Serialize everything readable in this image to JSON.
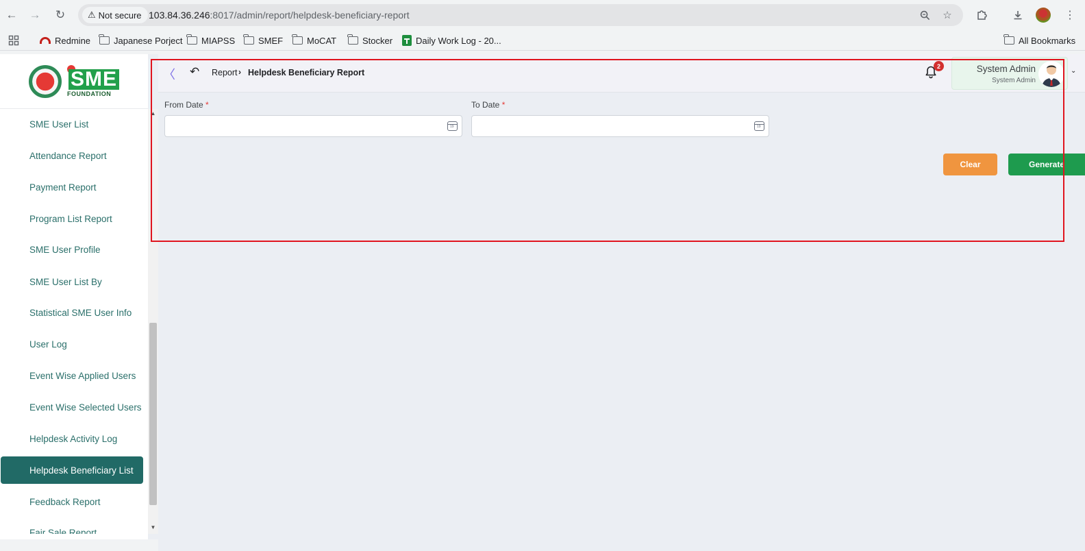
{
  "browser": {
    "security_label": "Not secure",
    "url_host": "103.84.36.246",
    "url_rest": ":8017/admin/report/helpdesk-beneficiary-report",
    "bookmarks": [
      {
        "label": "Redmine",
        "icon": "redmine-icon"
      },
      {
        "label": "Japanese Porject",
        "icon": "folder-icon"
      },
      {
        "label": "MIAPSS",
        "icon": "folder-icon"
      },
      {
        "label": "SMEF",
        "icon": "folder-icon"
      },
      {
        "label": "MoCAT",
        "icon": "folder-icon"
      },
      {
        "label": "Stocker",
        "icon": "folder-icon"
      },
      {
        "label": "Daily Work Log - 20...",
        "icon": "sheets-icon"
      }
    ],
    "all_bookmarks_label": "All Bookmarks"
  },
  "sidebar": {
    "logo_text": "SME",
    "logo_subtext": "FOUNDATION",
    "items": [
      {
        "label": "SME User List"
      },
      {
        "label": "Attendance Report"
      },
      {
        "label": "Payment Report"
      },
      {
        "label": "Program List Report"
      },
      {
        "label": "SME User Profile"
      },
      {
        "label": "SME User List By"
      },
      {
        "label": "Statistical SME User Info"
      },
      {
        "label": "User Log"
      },
      {
        "label": "Event Wise Applied Users"
      },
      {
        "label": "Event Wise Selected Users"
      },
      {
        "label": "Helpdesk Activity Log"
      },
      {
        "label": "Helpdesk Beneficiary List",
        "active": true
      },
      {
        "label": "Feedback Report"
      },
      {
        "label": "Fair Sale Report"
      }
    ]
  },
  "header": {
    "breadcrumb_root": "Report",
    "breadcrumb_current": "Helpdesk Beneficiary Report",
    "notification_count": "2",
    "user_name": "System Admin",
    "user_role": "System Admin"
  },
  "form": {
    "from_date_label": "From Date",
    "to_date_label": "To Date",
    "required_mark": "*",
    "from_date_value": "",
    "to_date_value": "",
    "clear_label": "Clear",
    "generate_label": "Generate"
  },
  "colors": {
    "accent_teal": "#216a66",
    "clear_orange": "#f0953f",
    "generate_green": "#1e9b4e",
    "highlight_red": "#e0141e"
  }
}
